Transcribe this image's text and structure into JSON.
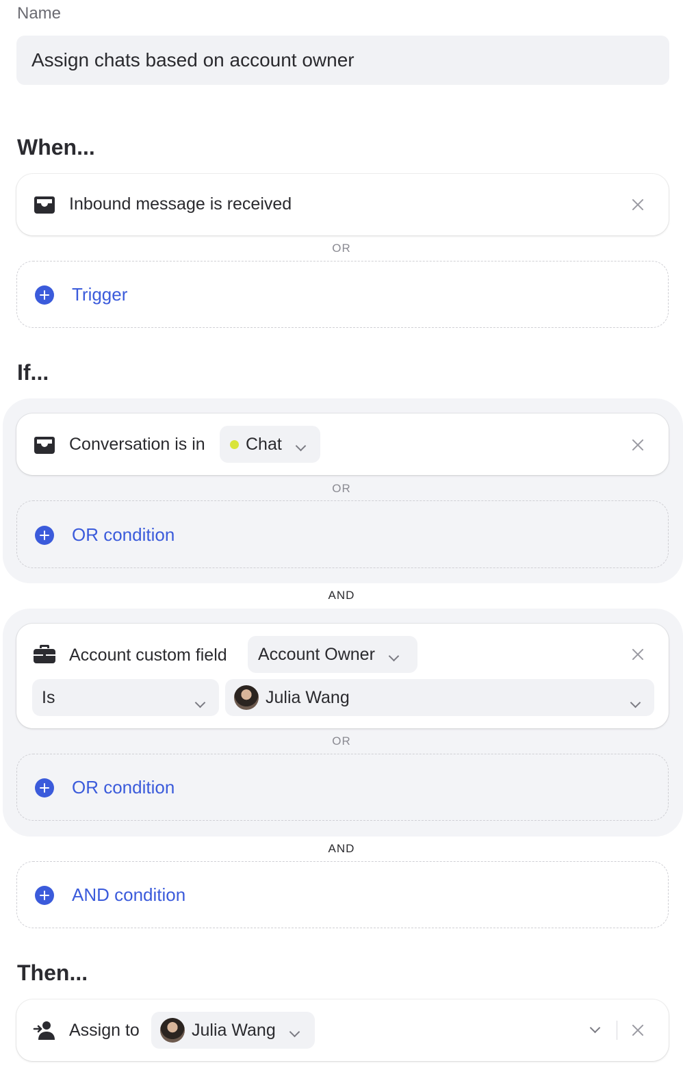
{
  "name_field": {
    "label": "Name",
    "value": "Assign chats based on account owner"
  },
  "when": {
    "title": "When...",
    "trigger_label": "Inbound message is received",
    "or_label": "OR",
    "add_label": "Trigger",
    "icon": "inbox-icon"
  },
  "if": {
    "title": "If...",
    "group1": {
      "condition_label": "Conversation is in",
      "channel_value": "Chat",
      "channel_dot_color": "#d9e43a",
      "or_label": "OR",
      "add_label": "OR condition",
      "icon": "inbox-icon"
    },
    "and_label_1": "AND",
    "group2": {
      "condition_label": "Account custom field",
      "field_value": "Account Owner",
      "operator_value": "Is",
      "user_value": "Julia Wang",
      "or_label": "OR",
      "add_label": "OR condition",
      "icon": "briefcase-icon"
    },
    "and_label_2": "AND",
    "add_and_label": "AND condition"
  },
  "then": {
    "title": "Then...",
    "action_label": "Assign to",
    "assignee_value": "Julia Wang",
    "icon": "assign-user-icon"
  },
  "colors": {
    "accent": "#3b5bdb",
    "muted": "#8a8a92",
    "field_bg": "#f1f2f5",
    "group_bg": "#f3f4f7"
  }
}
